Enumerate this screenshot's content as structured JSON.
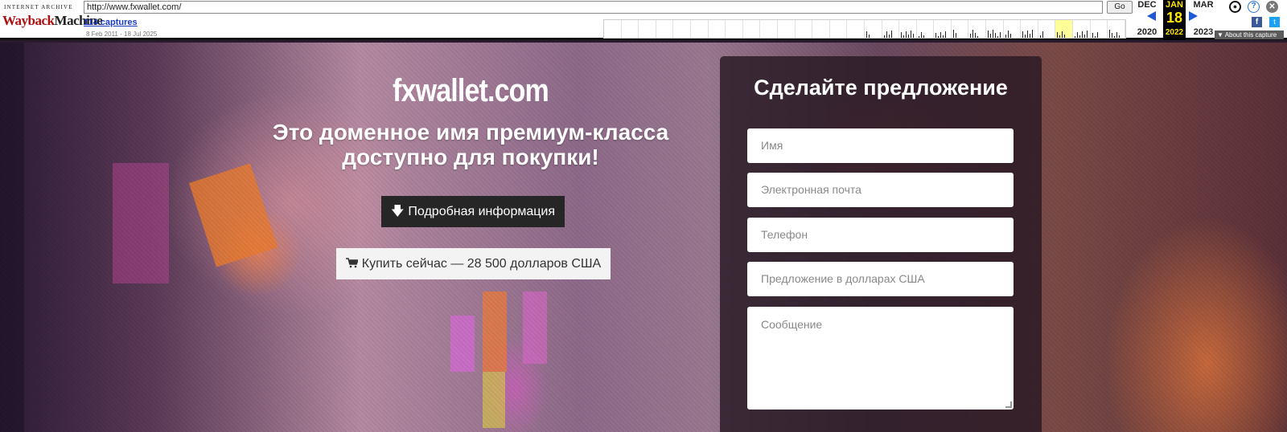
{
  "wayback": {
    "logo_top": "INTERNET ARCHIVE",
    "logo_main_a": "Wayback",
    "logo_main_b": "Machine",
    "url": "http://www.fxwallet.com/",
    "go_label": "Go",
    "captures_label": "114 captures",
    "date_range": "8 Feb 2011 - 18 Jul 2025",
    "prev": {
      "month": "DEC",
      "year": "2020"
    },
    "current": {
      "month": "JAN",
      "day": "18",
      "year": "2022"
    },
    "next": {
      "month": "MAR",
      "year": "2023"
    },
    "about_label": "▼ About this capture",
    "user_icon": "user-icon",
    "help_icon": "help-icon",
    "close_icon": "close-icon",
    "facebook_icon": "facebook-icon",
    "twitter_icon": "twitter-icon"
  },
  "hero": {
    "domain": "fxwallet.com",
    "tagline": "Это доменное имя премиум-класса доступно для покупки!",
    "more_info_label": "Подробная информация",
    "buy_label": "Купить сейчас — 28 500 долларов США",
    "more_info_icon": "arrow-down-icon",
    "buy_icon": "cart-icon"
  },
  "offer_form": {
    "title": "Сделайте предложение",
    "name_placeholder": "Имя",
    "email_placeholder": "Электронная почта",
    "phone_placeholder": "Телефон",
    "offer_placeholder": "Предложение в долларах США",
    "message_placeholder": "Сообщение"
  },
  "colors": {
    "wayback_red": "#b01010",
    "link_blue": "#1a3cc0",
    "dark_button": "#262626",
    "panel_bg": "#281923"
  }
}
